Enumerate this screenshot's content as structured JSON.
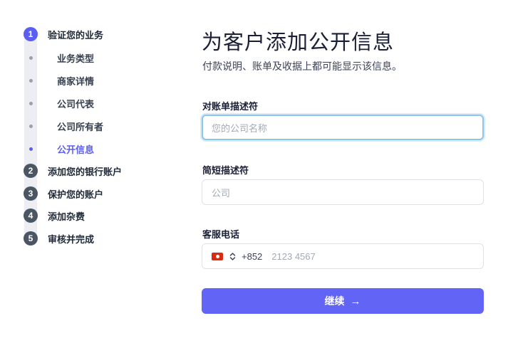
{
  "sidebar": {
    "steps": [
      {
        "number": "1",
        "label": "验证您的业务"
      },
      {
        "number": "2",
        "label": "添加您的银行账户"
      },
      {
        "number": "3",
        "label": "保护您的账户"
      },
      {
        "number": "4",
        "label": "添加杂费"
      },
      {
        "number": "5",
        "label": "审核并完成"
      }
    ],
    "substeps": [
      {
        "label": "业务类型"
      },
      {
        "label": "商家详情"
      },
      {
        "label": "公司代表"
      },
      {
        "label": "公司所有者"
      },
      {
        "label": "公开信息"
      }
    ],
    "active_step": "1",
    "active_substep": "公开信息"
  },
  "main": {
    "title": "为客户添加公开信息",
    "subtitle": "付款说明、账单及收据上都可能显示该信息。",
    "fields": {
      "statement_descriptor": {
        "label": "对账单描述符",
        "placeholder": "您的公司名称",
        "value": ""
      },
      "short_descriptor": {
        "label": "简短描述符",
        "placeholder": "公司",
        "value": ""
      },
      "phone": {
        "label": "客服电话",
        "country_flag": "hong-kong-flag",
        "prefix": "+852",
        "placeholder": "2123 4567",
        "value": ""
      }
    },
    "continue_button": {
      "label": "继续",
      "icon": "arrow-right-icon"
    }
  },
  "colors": {
    "accent": "#5a5ff2",
    "button": "#6264f5",
    "focus_ring": "#8ec5ea",
    "completed_step": "#4b5563"
  }
}
